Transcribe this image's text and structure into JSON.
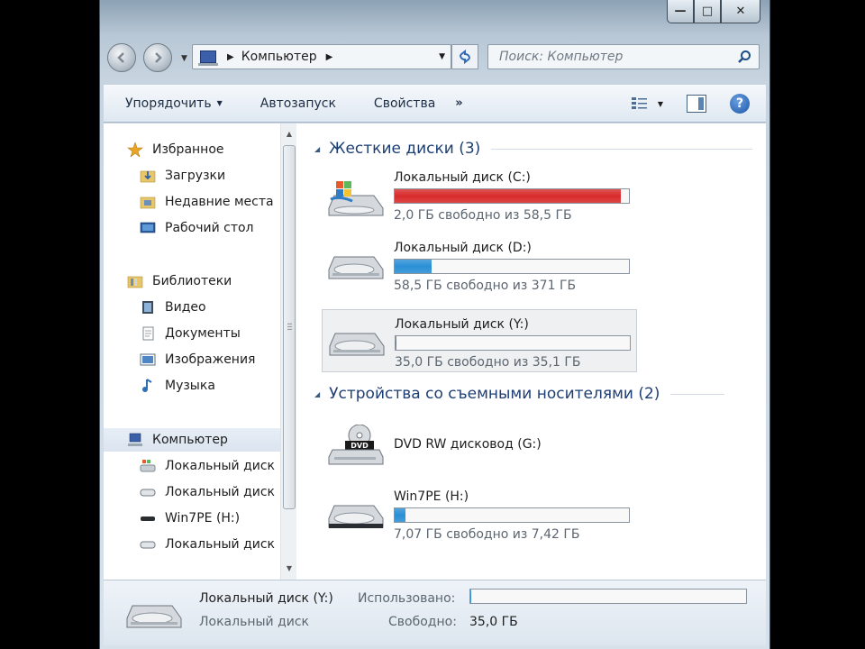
{
  "window": {
    "caption_buttons": {
      "minimize": "—",
      "maximize": "□",
      "close": "✕"
    }
  },
  "navbar": {
    "back_icon": "back-arrow-icon",
    "forward_icon": "forward-arrow-icon",
    "address_crumb": "Компьютер",
    "search_placeholder": "Поиск: Компьютер"
  },
  "toolbar": {
    "organize": "Упорядочить",
    "autoplay": "Автозапуск",
    "properties": "Свойства",
    "more": "»"
  },
  "sidebar": {
    "favorites": {
      "label": "Избранное",
      "items": [
        {
          "label": "Загрузки",
          "icon": "downloads-folder-icon"
        },
        {
          "label": "Недавние места",
          "icon": "recent-places-icon"
        },
        {
          "label": "Рабочий стол",
          "icon": "desktop-icon"
        }
      ]
    },
    "libraries": {
      "label": "Библиотеки",
      "items": [
        {
          "label": "Видео",
          "icon": "video-library-icon"
        },
        {
          "label": "Документы",
          "icon": "documents-library-icon"
        },
        {
          "label": "Изображения",
          "icon": "pictures-library-icon"
        },
        {
          "label": "Музыка",
          "icon": "music-library-icon"
        }
      ]
    },
    "computer": {
      "label": "Компьютер",
      "items": [
        {
          "label": "Локальный диск",
          "icon": "windows-drive-icon"
        },
        {
          "label": "Локальный диск",
          "icon": "hard-drive-icon"
        },
        {
          "label": "Win7PE (H:)",
          "icon": "usb-drive-icon"
        },
        {
          "label": "Локальный диск",
          "icon": "hard-drive-icon"
        }
      ]
    }
  },
  "content": {
    "hard_disks": {
      "title": "Жесткие диски (3)",
      "drives": [
        {
          "name": "Локальный диск (C:)",
          "free_text": "2,0 ГБ свободно из 58,5 ГБ",
          "used_fraction": 0.966,
          "bar_color": "#d92b2b"
        },
        {
          "name": "Локальный диск (D:)",
          "free_text": "58,5 ГБ свободно из 371 ГБ",
          "used_fraction": 0.158,
          "bar_color": "#2a8fd6"
        },
        {
          "name": "Локальный диск (Y:)",
          "free_text": "35,0 ГБ свободно из 35,1 ГБ",
          "used_fraction": 0.003,
          "bar_color": "#2a8fd6"
        }
      ]
    },
    "removable": {
      "title": "Устройства со съемными носителями (2)",
      "drives": [
        {
          "name": "DVD RW дисковод (G:)"
        },
        {
          "name": "Win7PE (H:)",
          "free_text": "7,07 ГБ свободно из 7,42 ГБ",
          "used_fraction": 0.047,
          "bar_color": "#2a8fd6"
        }
      ]
    }
  },
  "details": {
    "name": "Локальный диск (Y:)",
    "type": "Локальный диск",
    "used_label": "Использовано:",
    "free_label": "Свободно:",
    "free_value": "35,0 ГБ",
    "used_fraction": 0.003
  }
}
